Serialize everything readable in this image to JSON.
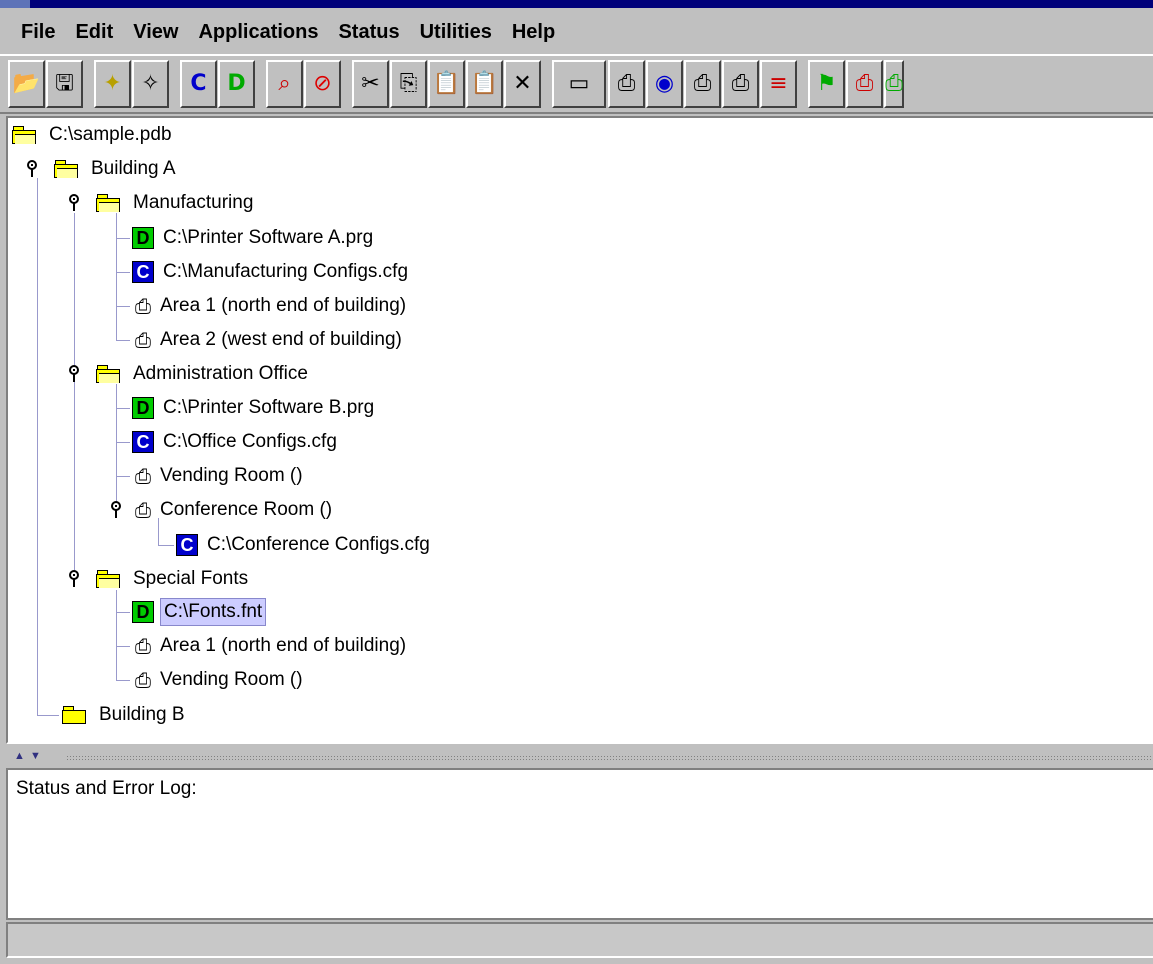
{
  "menu": [
    "File",
    "Edit",
    "View",
    "Applications",
    "Status",
    "Utilities",
    "Help"
  ],
  "toolbar_icons": [
    "open-folder-icon",
    "save-icon",
    "new-folder-icon",
    "new-item-icon",
    "new-config-icon",
    "new-download-icon",
    "find-icon",
    "stop-icon",
    "cut-icon",
    "copy-icon",
    "paste-icon",
    "paste-special-icon",
    "delete-icon",
    "device-icon",
    "printer-settings-icon",
    "printer-config-icon",
    "printer-c-icon",
    "printer-d-icon",
    "printer-error-icon",
    "flag-icon",
    "printer-alert-icon",
    "printer-go-icon"
  ],
  "tree": {
    "root": "C:\\sample.pdb",
    "building_a": "Building A",
    "manufacturing": "Manufacturing",
    "mfg_software": "C:\\Printer Software A.prg",
    "mfg_configs": "C:\\Manufacturing Configs.cfg",
    "mfg_area1": "Area 1 (north end of building)",
    "mfg_area2": "Area 2 (west end of building)",
    "admin_office": "Administration Office",
    "admin_software": "C:\\Printer Software B.prg",
    "admin_configs": "C:\\Office Configs.cfg",
    "admin_vending": "Vending Room ()",
    "admin_conference": "Conference Room ()",
    "conference_configs": "C:\\Conference Configs.cfg",
    "special_fonts": "Special Fonts",
    "fonts_file": "C:\\Fonts.fnt",
    "fonts_area1": "Area 1 (north end of building)",
    "fonts_vending": "Vending Room ()",
    "building_b": "Building B"
  },
  "badges": {
    "download": "D",
    "config": "C"
  },
  "log": {
    "title": "Status and Error Log:"
  },
  "colors": {
    "selection": "#ccccff",
    "title_bar": "#00007a",
    "tree_lines": "#9999cc"
  }
}
